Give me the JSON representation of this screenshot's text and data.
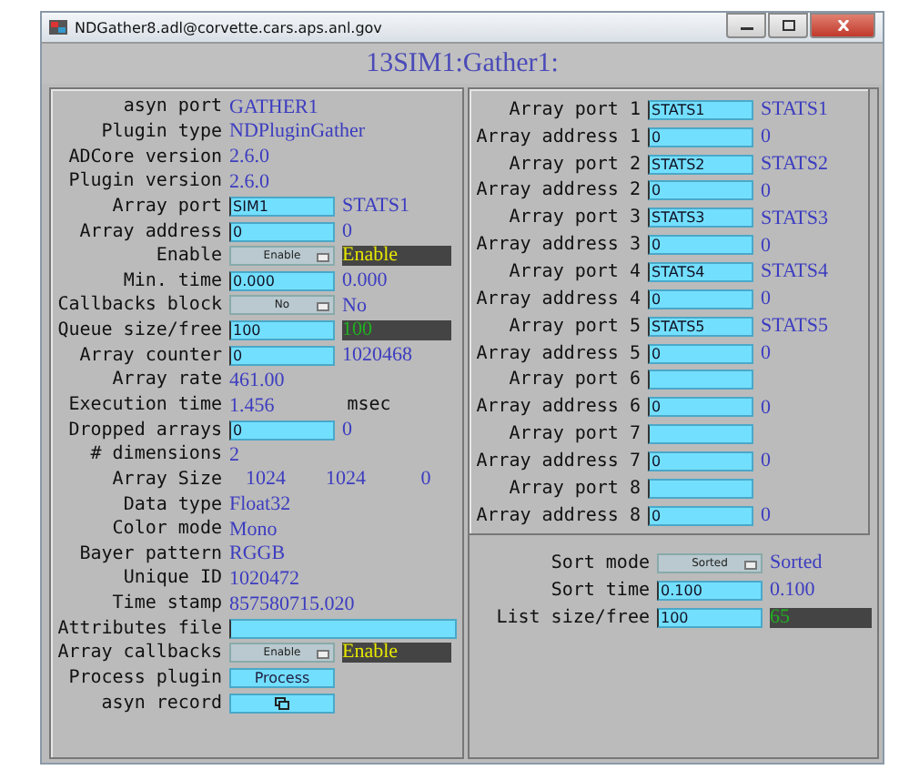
{
  "window": {
    "title": "NDGather8.adl@corvette.cars.aps.anl.gov"
  },
  "header": "13SIM1:Gather1:",
  "left_panel": {
    "rows": [
      {
        "kind": "text",
        "label": "asyn port",
        "value": "GATHER1"
      },
      {
        "kind": "text",
        "label": "Plugin type",
        "value": "NDPluginGather"
      },
      {
        "kind": "text",
        "label": "ADCore version",
        "value": "2.6.0"
      },
      {
        "kind": "text",
        "label": "Plugin version",
        "value": "2.6.0"
      },
      {
        "kind": "input",
        "label": "Array port",
        "value": "SIM1",
        "readback": {
          "kind": "plain",
          "text": "STATS1"
        }
      },
      {
        "kind": "input",
        "label": "Array address",
        "value": "0",
        "readback": {
          "kind": "plain",
          "text": "0"
        }
      },
      {
        "kind": "menu",
        "label": "Enable",
        "value": "Enable",
        "readback": {
          "kind": "enabled",
          "text": "Enable"
        }
      },
      {
        "kind": "input",
        "label": "Min. time",
        "value": "0.000",
        "readback": {
          "kind": "plain",
          "text": "0.000"
        }
      },
      {
        "kind": "menu",
        "label": "Callbacks block",
        "value": "No",
        "readback": {
          "kind": "plain",
          "text": "No"
        }
      },
      {
        "kind": "input",
        "label": "Queue size/free",
        "value": "100",
        "readback": {
          "kind": "count",
          "text": "100"
        }
      },
      {
        "kind": "input",
        "label": "Array counter",
        "value": "0",
        "readback": {
          "kind": "plain",
          "text": "1020468"
        }
      },
      {
        "kind": "text",
        "label": "Array rate",
        "value": "461.00"
      },
      {
        "kind": "text",
        "label": "Execution time",
        "value": "1.456",
        "unit": "msec"
      },
      {
        "kind": "input",
        "label": "Dropped arrays",
        "value": "0",
        "readback": {
          "kind": "plain",
          "text": "0"
        }
      },
      {
        "kind": "text",
        "label": "# dimensions",
        "value": "2"
      },
      {
        "kind": "triple",
        "label": "Array Size",
        "values": [
          "1024",
          "1024",
          "0"
        ]
      },
      {
        "kind": "text",
        "label": "Data type",
        "value": "Float32"
      },
      {
        "kind": "text",
        "label": "Color mode",
        "value": "Mono"
      },
      {
        "kind": "text",
        "label": "Bayer pattern",
        "value": "RGGB"
      },
      {
        "kind": "text",
        "label": "Unique ID",
        "value": "1020472"
      },
      {
        "kind": "text",
        "label": "Time stamp",
        "value": "857580715.020"
      },
      {
        "kind": "wide_input",
        "label": "Attributes file"
      },
      {
        "kind": "menu",
        "label": "Array callbacks",
        "value": "Enable",
        "readback": {
          "kind": "enabled",
          "text": "Enable"
        }
      },
      {
        "kind": "button",
        "label": "Process plugin",
        "value": "Process"
      },
      {
        "kind": "icon_button",
        "label": "asyn record"
      }
    ]
  },
  "right_panel": {
    "rows": [
      {
        "kind": "input",
        "label": "Array port 1",
        "value": "STATS1",
        "readback": {
          "kind": "plain",
          "text": "STATS1"
        }
      },
      {
        "kind": "input",
        "label": "Array address 1",
        "value": "0",
        "readback": {
          "kind": "plain",
          "text": "0"
        }
      },
      {
        "kind": "input",
        "label": "Array port 2",
        "value": "STATS2",
        "readback": {
          "kind": "plain",
          "text": "STATS2"
        }
      },
      {
        "kind": "input",
        "label": "Array address 2",
        "value": "0",
        "readback": {
          "kind": "plain",
          "text": "0"
        }
      },
      {
        "kind": "input",
        "label": "Array port 3",
        "value": "STATS3",
        "readback": {
          "kind": "plain",
          "text": "STATS3"
        }
      },
      {
        "kind": "input",
        "label": "Array address 3",
        "value": "0",
        "readback": {
          "kind": "plain",
          "text": "0"
        }
      },
      {
        "kind": "input",
        "label": "Array port 4",
        "value": "STATS4",
        "readback": {
          "kind": "plain",
          "text": "STATS4"
        }
      },
      {
        "kind": "input",
        "label": "Array address 4",
        "value": "0",
        "readback": {
          "kind": "plain",
          "text": "0"
        }
      },
      {
        "kind": "input",
        "label": "Array port 5",
        "value": "STATS5",
        "readback": {
          "kind": "plain",
          "text": "STATS5"
        }
      },
      {
        "kind": "input",
        "label": "Array address 5",
        "value": "0",
        "readback": {
          "kind": "plain",
          "text": "0"
        }
      },
      {
        "kind": "input",
        "label": "Array port 6"
      },
      {
        "kind": "input",
        "label": "Array address 6",
        "value": "0",
        "readback": {
          "kind": "plain",
          "text": "0"
        }
      },
      {
        "kind": "input",
        "label": "Array port 7"
      },
      {
        "kind": "input",
        "label": "Array address 7",
        "value": "0",
        "readback": {
          "kind": "plain",
          "text": "0"
        }
      },
      {
        "kind": "input",
        "label": "Array port 8"
      },
      {
        "kind": "input",
        "label": "Array address 8",
        "value": "0",
        "readback": {
          "kind": "plain",
          "text": "0"
        }
      }
    ]
  },
  "sort_panel": {
    "rows": [
      {
        "kind": "menu",
        "label": "Sort mode",
        "value": "Sorted",
        "readback": {
          "kind": "plain",
          "text": "Sorted"
        }
      },
      {
        "kind": "input",
        "label": "Sort time",
        "value": "0.100",
        "readback": {
          "kind": "plain",
          "text": "0.100"
        }
      },
      {
        "kind": "input",
        "label": "List size/free",
        "value": "100",
        "readback": {
          "kind": "count",
          "text": "65"
        }
      }
    ]
  }
}
